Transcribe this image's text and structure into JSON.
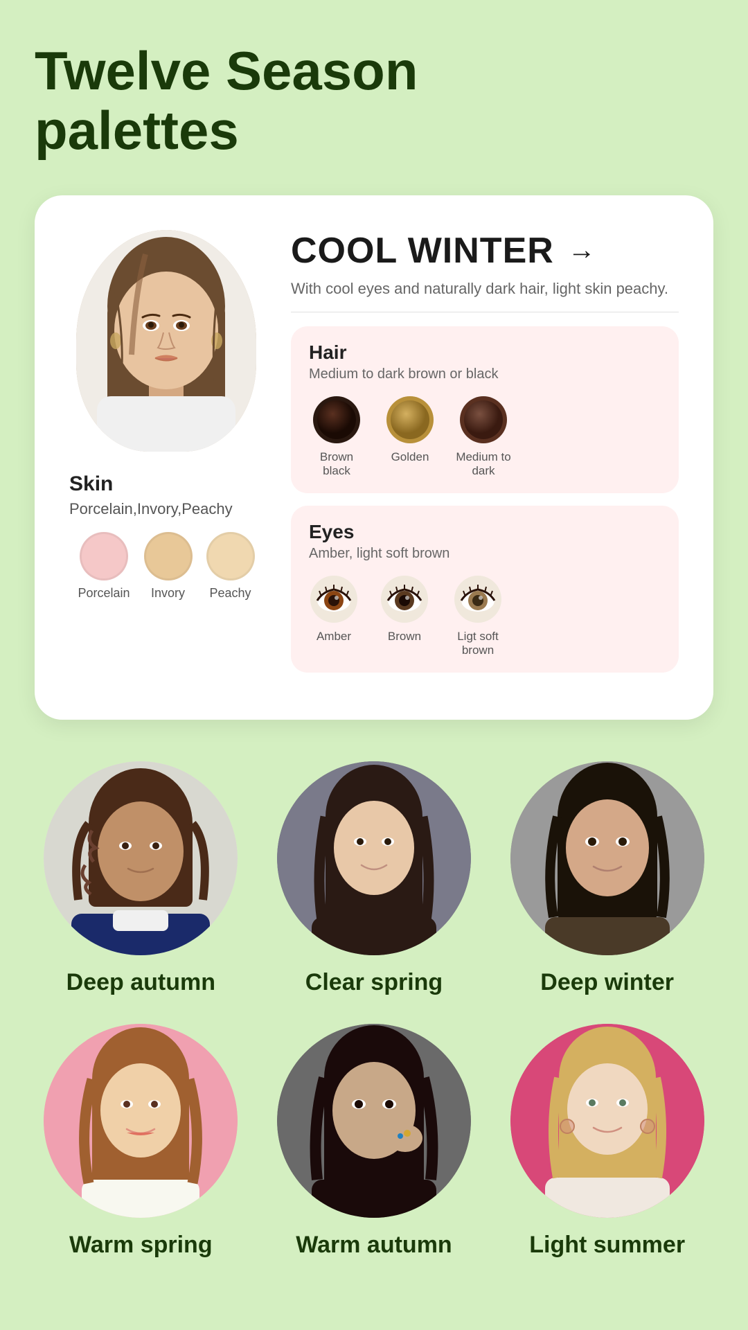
{
  "title": "Twelve Season palettes",
  "card": {
    "season_name": "COOL WINTER",
    "season_desc": "With cool eyes and naturally dark hair, light skin peachy.",
    "arrow": "→",
    "skin": {
      "label": "Skin",
      "subtitle": "Porcelain,Invory,Peachy",
      "swatches": [
        {
          "id": "porcelain",
          "label": "Porcelain",
          "color": "#f5c8c8"
        },
        {
          "id": "invory",
          "label": "Invory",
          "color": "#e8c898"
        },
        {
          "id": "peachy",
          "label": "Peachy",
          "color": "#f0d8b0"
        }
      ]
    },
    "hair": {
      "title": "Hair",
      "subtitle": "Medium to dark brown or black",
      "swatches": [
        {
          "id": "brown-black",
          "label": "Brown black",
          "color": "#2a1810"
        },
        {
          "id": "golden",
          "label": "Golden",
          "color": "#b8903a"
        },
        {
          "id": "medium-dark",
          "label": "Medium to dark",
          "color": "#5a3020"
        }
      ]
    },
    "eyes": {
      "title": "Eyes",
      "subtitle": "Amber, light soft brown",
      "swatches": [
        {
          "id": "amber",
          "label": "Amber",
          "color": "#8B4513"
        },
        {
          "id": "brown",
          "label": "Brown",
          "color": "#5a3a20"
        },
        {
          "id": "light-soft-brown",
          "label": "Ligt soft brown",
          "color": "#9a7a50"
        }
      ]
    }
  },
  "season_grid_row1": [
    {
      "id": "deep-autumn",
      "label": "Deep autumn",
      "bg": "warm-light"
    },
    {
      "id": "clear-spring",
      "label": "Clear spring",
      "bg": "cool-dark"
    },
    {
      "id": "deep-winter",
      "label": "Deep winter",
      "bg": "deep-winter"
    }
  ],
  "season_grid_row2": [
    {
      "id": "warm-spring",
      "label": "Warm spring",
      "bg": "warm-spring"
    },
    {
      "id": "warm-autumn",
      "label": "Warm autumn",
      "bg": "warm-autumn"
    },
    {
      "id": "light-summer",
      "label": "Light summer",
      "bg": "light-summer"
    }
  ]
}
